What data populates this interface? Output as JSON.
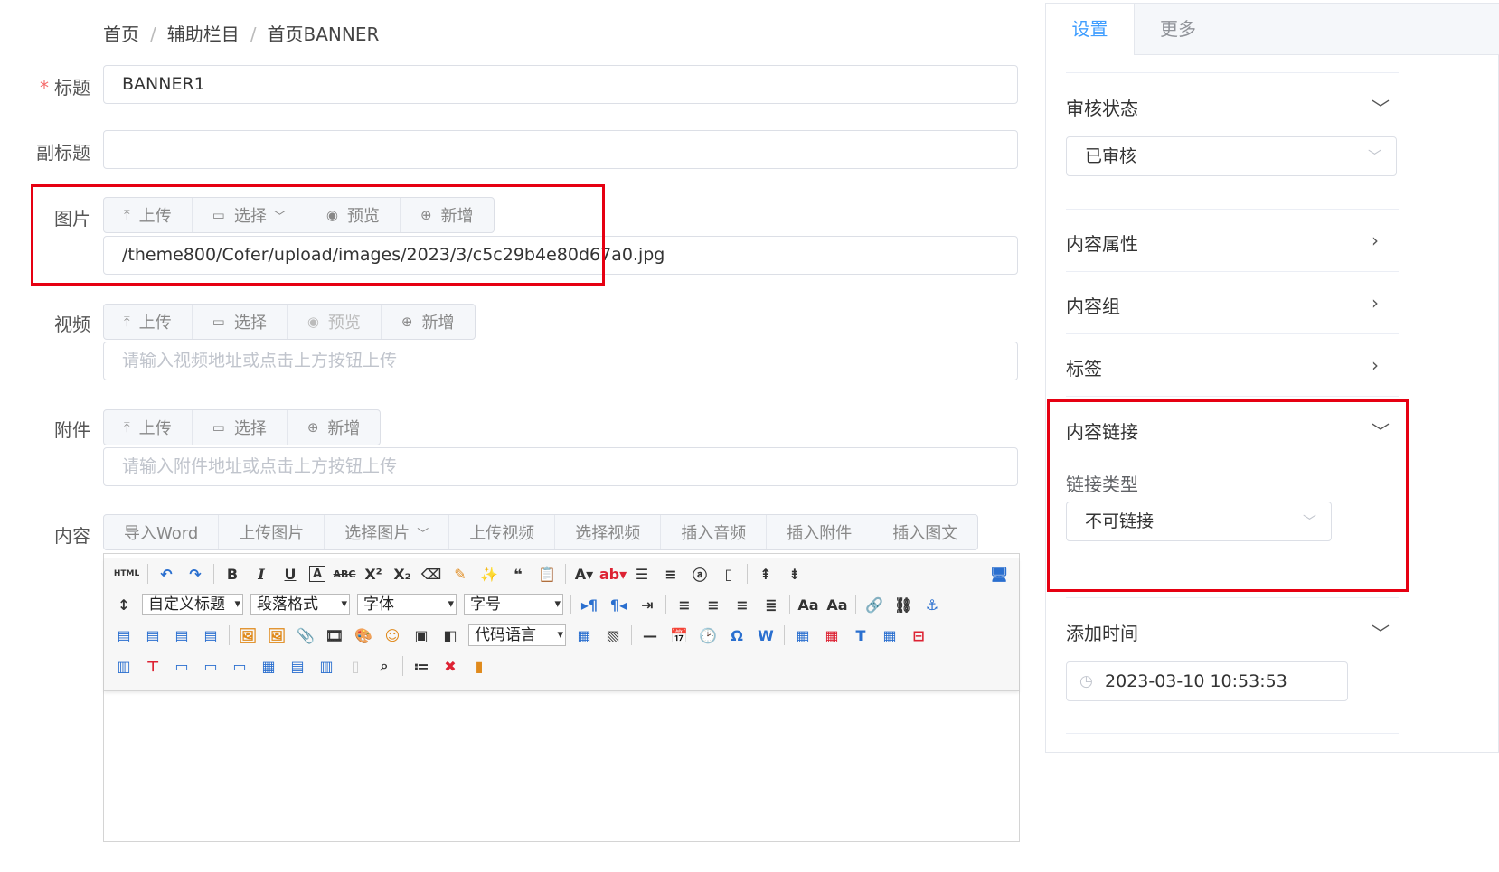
{
  "breadcrumb": [
    "首页",
    "辅助栏目",
    "首页BANNER"
  ],
  "breadcrumb_sep": "/",
  "form": {
    "title": {
      "required_mark": "*",
      "label": "标题",
      "value": "BANNER1"
    },
    "subtitle": {
      "label": "副标题",
      "value": ""
    },
    "image": {
      "label": "图片",
      "buttons": [
        "上传",
        "选择",
        "预览",
        "新增"
      ],
      "value": "/theme800/Cofer/upload/images/2023/3/c5c29b4e80d67a0.jpg"
    },
    "video": {
      "label": "视频",
      "buttons": [
        "上传",
        "选择",
        "预览",
        "新增"
      ],
      "placeholder": "请输入视频地址或点击上方按钮上传"
    },
    "attachment": {
      "label": "附件",
      "buttons": [
        "上传",
        "选择",
        "新增"
      ],
      "placeholder": "请输入附件地址或点击上方按钮上传"
    },
    "content": {
      "label": "内容",
      "buttons": [
        "导入Word",
        "上传图片",
        "选择图片",
        "上传视频",
        "选择视频",
        "插入音频",
        "插入附件",
        "插入图文"
      ]
    }
  },
  "editor": {
    "selects": {
      "custom_title": "自定义标题",
      "paragraph": "段落格式",
      "font": "字体",
      "font_size": "字号",
      "code_lang": "代码语言"
    },
    "html_label": "HTML"
  },
  "sidebar": {
    "tabs": [
      "设置",
      "更多"
    ],
    "review_status": {
      "title": "审核状态",
      "value": "已审核"
    },
    "content_props": {
      "title": "内容属性"
    },
    "content_group": {
      "title": "内容组"
    },
    "tags": {
      "title": "标签"
    },
    "content_link": {
      "title": "内容链接",
      "link_type_label": "链接类型",
      "link_type_value": "不可链接"
    },
    "add_time": {
      "title": "添加时间",
      "value": "2023-03-10 10:53:53"
    }
  },
  "colors": {
    "accent": "#409eff",
    "highlight": "#e60012",
    "required": "#f56c6c"
  }
}
